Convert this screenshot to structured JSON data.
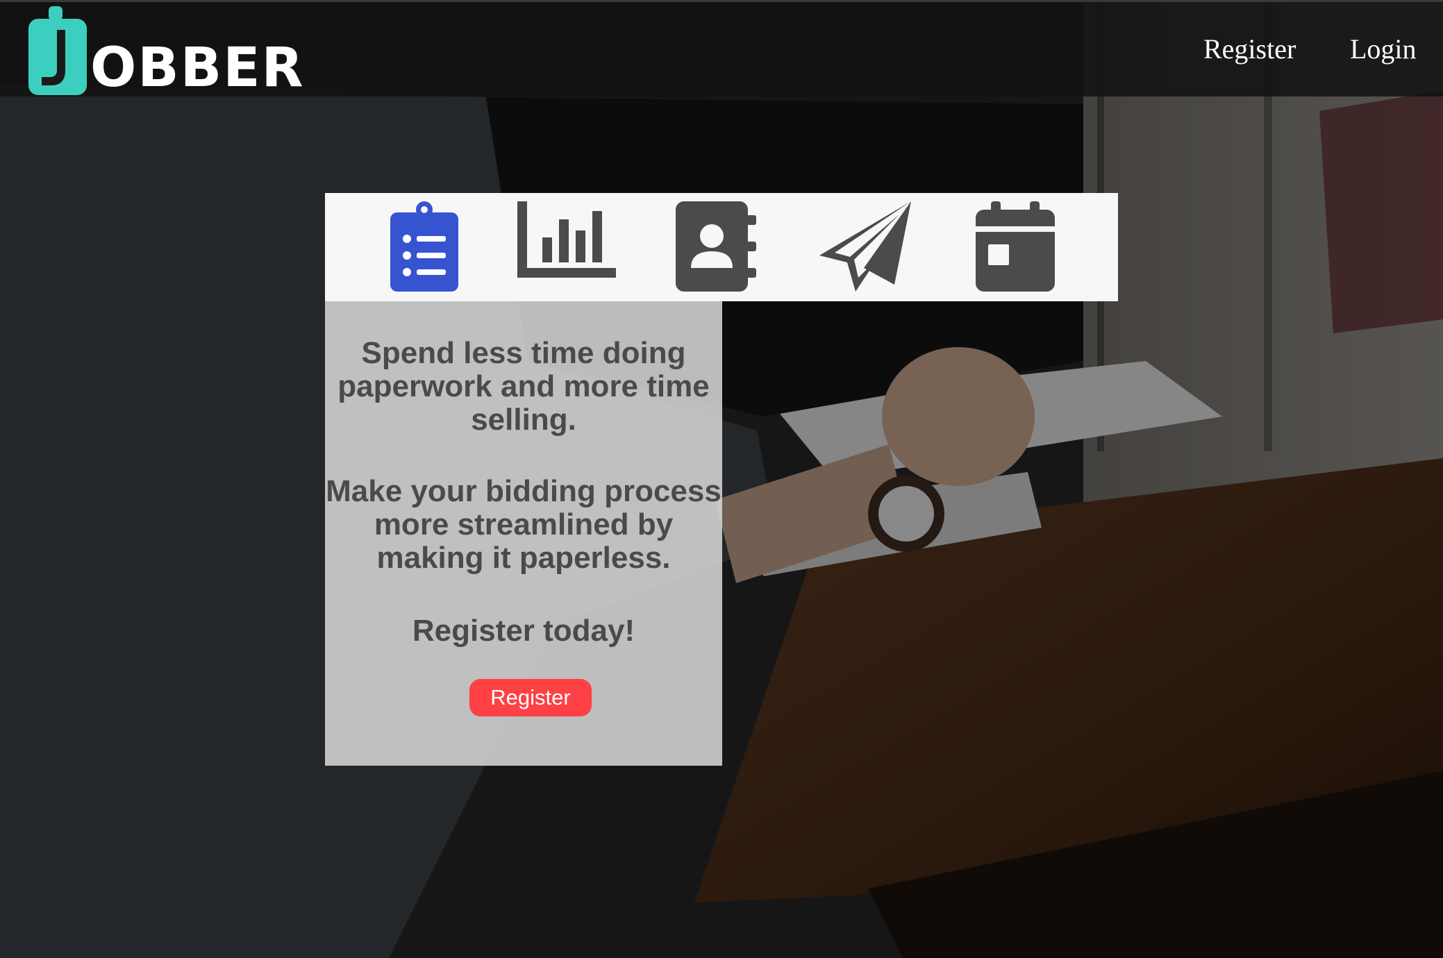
{
  "brand": {
    "name": "OBBER",
    "logo_mark": "clipboard-letter-j",
    "logo_color": "#3ccfbf"
  },
  "nav": {
    "register_label": "Register",
    "login_label": "Login"
  },
  "features": {
    "icons": [
      "clipboard-list-icon",
      "bar-chart-icon",
      "address-book-icon",
      "paper-plane-icon",
      "calendar-icon"
    ],
    "active_color": "#3653d0",
    "inactive_color": "#4b4b4b"
  },
  "panel": {
    "tagline": "Spend less time doing paperwork and more time selling.",
    "pitch": "Make your bidding process more streamlined by making it paperless.",
    "cta_text": "Register today!",
    "register_button_label": "Register",
    "button_color": "#ff4044"
  }
}
